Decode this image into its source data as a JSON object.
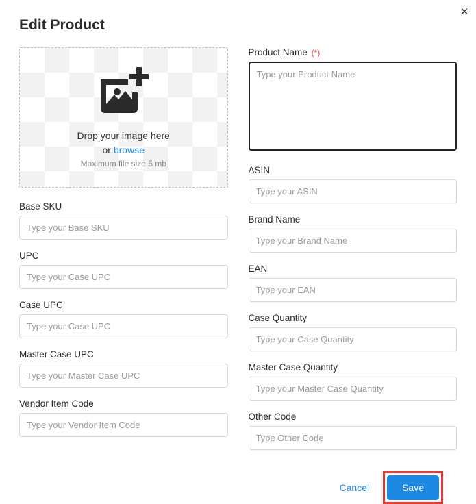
{
  "title": "Edit Product",
  "dropzone": {
    "line1": "Drop your image here",
    "or": "or ",
    "browse": "browse",
    "sub": "Maximum file size 5 mb"
  },
  "left": {
    "base_sku": {
      "label": "Base SKU",
      "placeholder": "Type your Base SKU"
    },
    "upc": {
      "label": "UPC",
      "placeholder": "Type your Case UPC"
    },
    "case_upc": {
      "label": "Case UPC",
      "placeholder": "Type your Case UPC"
    },
    "master_case_upc": {
      "label": "Master Case UPC",
      "placeholder": "Type your Master Case UPC"
    },
    "vendor_item_code": {
      "label": "Vendor Item Code",
      "placeholder": "Type your Vendor Item Code"
    }
  },
  "right": {
    "product_name": {
      "label": "Product Name",
      "req": "(*)",
      "placeholder": "Type your Product Name"
    },
    "asin": {
      "label": "ASIN",
      "placeholder": "Type your ASIN"
    },
    "brand_name": {
      "label": "Brand Name",
      "placeholder": "Type your Brand Name"
    },
    "ean": {
      "label": "EAN",
      "placeholder": "Type your EAN"
    },
    "case_quantity": {
      "label": "Case Quantity",
      "placeholder": "Type your Case Quantity"
    },
    "master_case_quantity": {
      "label": "Master Case Quantity",
      "placeholder": "Type your Master Case Quantity"
    },
    "other_code": {
      "label": "Other Code",
      "placeholder": "Type Other Code"
    }
  },
  "footer": {
    "cancel": "Cancel",
    "save": "Save"
  }
}
